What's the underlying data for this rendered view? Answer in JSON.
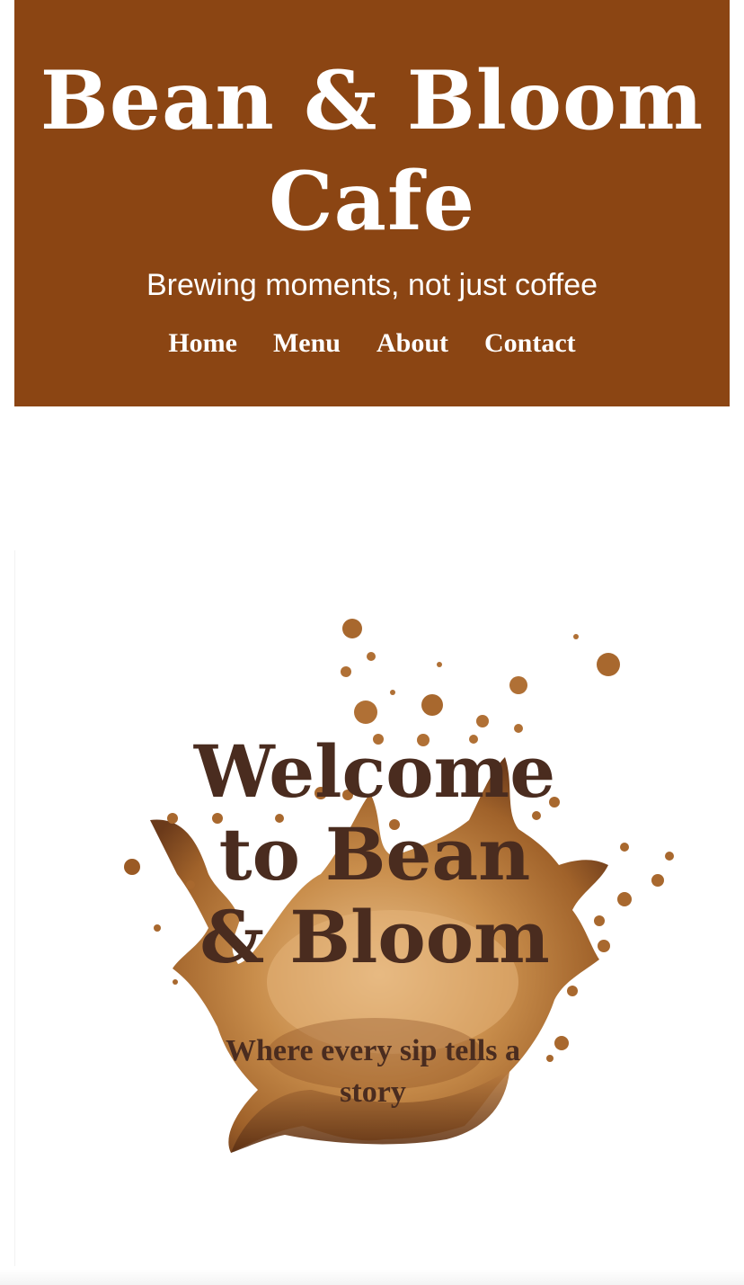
{
  "header": {
    "title": "Bean & Bloom Cafe",
    "tagline": "Brewing moments, not just coffee",
    "nav": [
      {
        "label": "Home"
      },
      {
        "label": "Menu"
      },
      {
        "label": "About"
      },
      {
        "label": "Contact"
      }
    ]
  },
  "hero": {
    "title": "Welcome to Bean & Bloom",
    "subtitle": "Where every sip tells a story",
    "image_icon": "coffee-splash-image"
  },
  "colors": {
    "header_bg": "#8b4513",
    "header_text": "#ffffff",
    "hero_text": "#4a2c1f",
    "coffee_light": "#d4a066",
    "coffee_mid": "#b8763a",
    "coffee_dark": "#6b3a1a"
  }
}
